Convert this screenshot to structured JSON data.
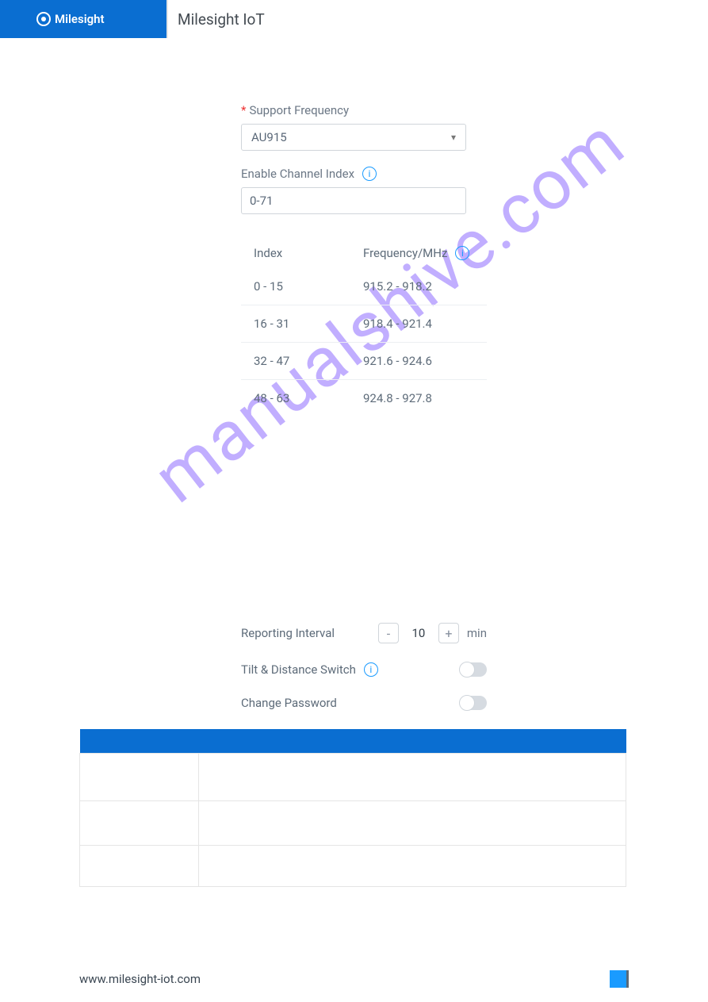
{
  "header": {
    "brand_text": "Milesight IoT"
  },
  "form": {
    "support_frequency_label": "Support Frequency",
    "support_frequency_value": "AU915",
    "enable_channel_label": "Enable Channel Index",
    "enable_channel_value": "0-71"
  },
  "channel_table": {
    "head_index": "Index",
    "head_freq": "Frequency/MHz",
    "rows": [
      {
        "index": "0 - 15",
        "freq": "915.2 - 918.2"
      },
      {
        "index": "16 - 31",
        "freq": "918.4 - 921.4"
      },
      {
        "index": "32 - 47",
        "freq": "921.6 - 924.6"
      },
      {
        "index": "48 - 63",
        "freq": "924.8 - 927.8"
      }
    ]
  },
  "settings": {
    "reporting_label": "Reporting Interval",
    "reporting_value": "10",
    "reporting_unit": "min",
    "reporting_minus": "-",
    "reporting_plus": "+",
    "tilt_label": "Tilt & Distance Switch",
    "change_pw_label": "Change Password"
  },
  "watermark": "manualshive.com",
  "footer": {
    "url": "www.milesight-iot.com"
  }
}
